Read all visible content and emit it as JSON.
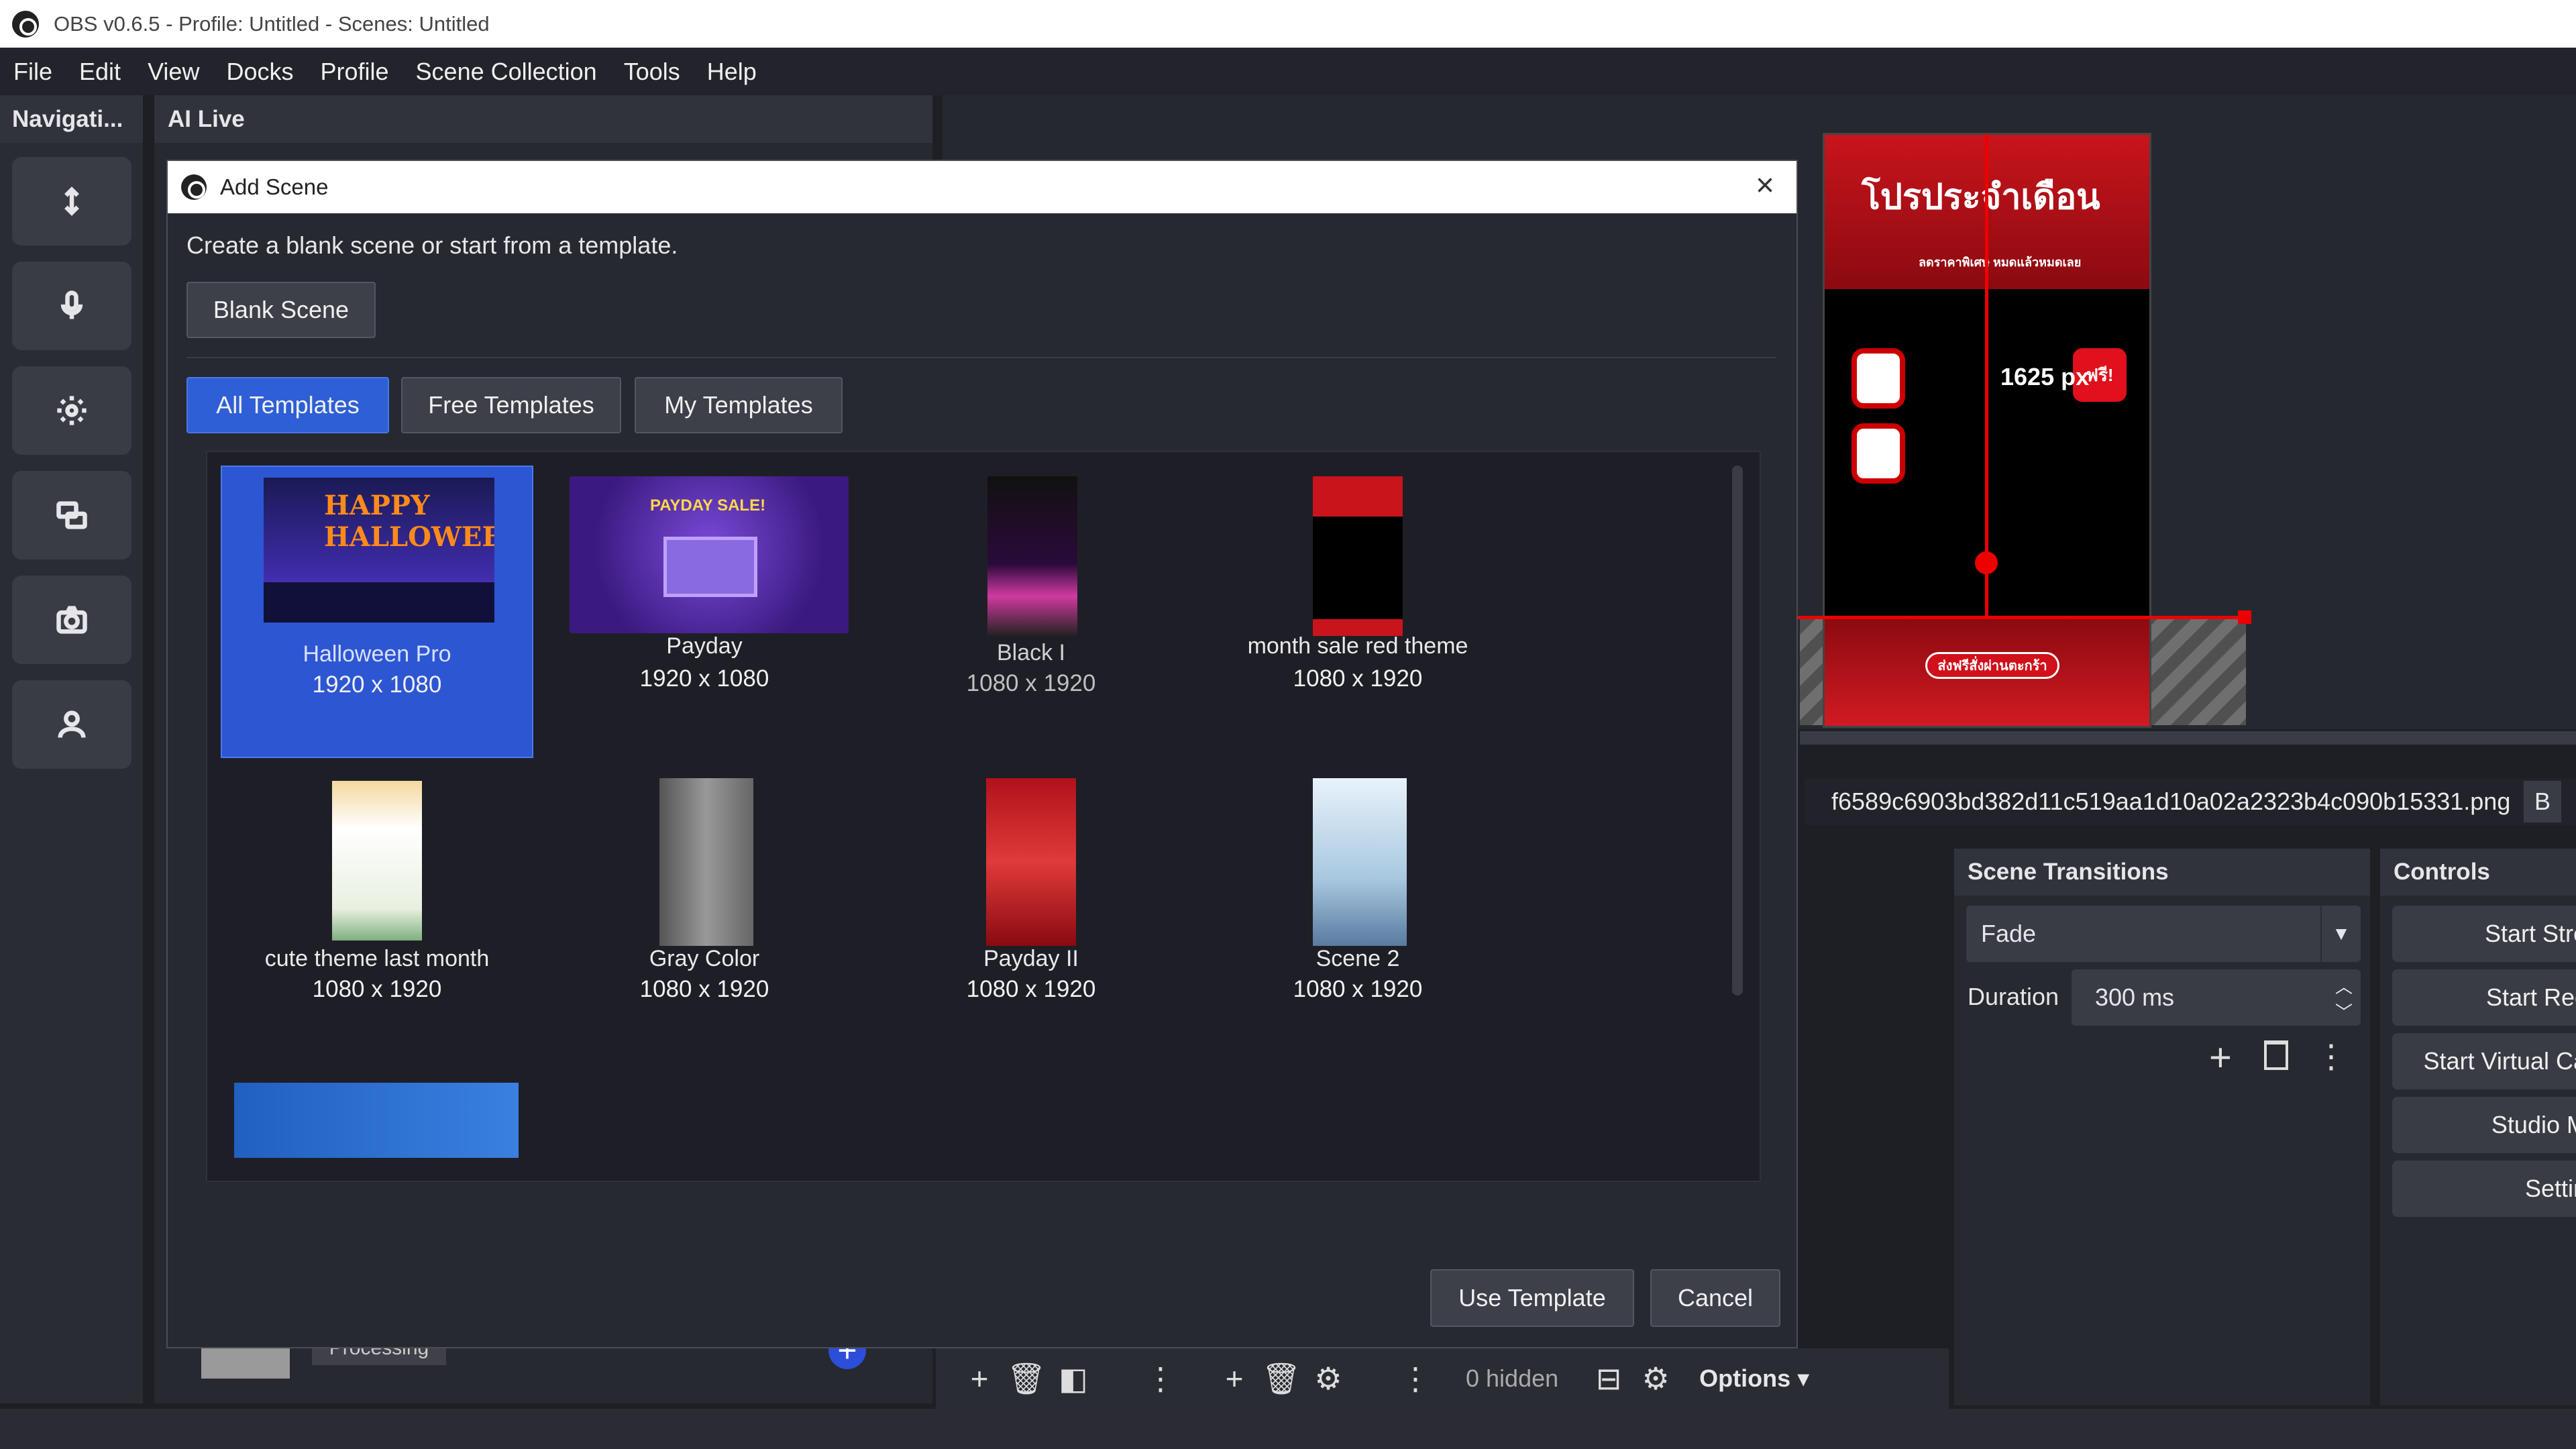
{
  "window": {
    "title": "OBS v0.6.5 - Profile: Untitled - Scenes: Untitled"
  },
  "menu": [
    "File",
    "Edit",
    "View",
    "Docks",
    "Profile",
    "Scene Collection",
    "Tools",
    "Help"
  ],
  "nav": {
    "title": "Navigati...",
    "icons": [
      "move-icon",
      "microphone-icon",
      "gear-icon",
      "scenes-icon",
      "camera-icon",
      "user-icon"
    ]
  },
  "ailive": {
    "title": "AI Live",
    "processing": "Processing"
  },
  "preview": {
    "banner_text": "โปรประจำเดือน",
    "banner_sub": "ลดราคาพิเศษ หมดแล้วหมดเลย",
    "measure": "1625 px",
    "badge": "ฟรี!",
    "cart_text": "ส่งฟรีสั่งผ่านตะกร้า"
  },
  "source": {
    "filename": "f6589c6903bd382d11c519aa1d10a02a2323b4c090b15331.png",
    "right_label": "B"
  },
  "transitions": {
    "title": "Scene Transitions",
    "type": "Fade",
    "duration_label": "Duration",
    "duration": "300 ms"
  },
  "controls": {
    "title": "Controls",
    "buttons": [
      "Start Stre",
      "Start Rec",
      "Start Virtual Ca",
      "Studio M",
      "Settin"
    ]
  },
  "bottom": {
    "hidden": "0 hidden",
    "options": "Options"
  },
  "dialog": {
    "title": "Add Scene",
    "prompt": "Create a blank scene or start from a template.",
    "blank": "Blank Scene",
    "tabs": [
      "All Templates",
      "Free Templates",
      "My Templates"
    ],
    "use": "Use Template",
    "cancel": "Cancel",
    "templates": [
      {
        "name": "Halloween Pro",
        "size": "1920 x 1080",
        "label": "HAPPY HALLOWEEN"
      },
      {
        "name": "Payday",
        "size": "1920 x 1080",
        "label": "PAYDAY SALE!"
      },
      {
        "name": "Black I",
        "size": "1080 x 1920"
      },
      {
        "name": "month sale red theme",
        "size": "1080 x 1920"
      },
      {
        "name": "cute theme last month",
        "size": "1080 x 1920"
      },
      {
        "name": "Gray Color",
        "size": "1080 x 1920"
      },
      {
        "name": "Payday II",
        "size": "1080 x 1920"
      },
      {
        "name": "Scene 2",
        "size": "1080 x 1920"
      }
    ]
  },
  "colors": {
    "accent": "#2e5fd6",
    "red": "#d21a22",
    "bg": "#1e1f25"
  }
}
